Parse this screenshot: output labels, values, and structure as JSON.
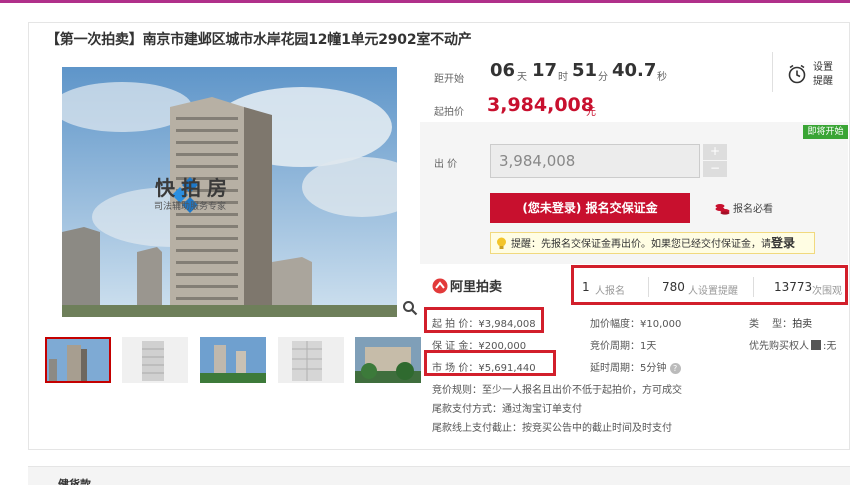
{
  "title": "【第一次拍卖】南京市建邺区城市水岸花园12幢1单元2902室不动产",
  "countdown": {
    "label": "距开始",
    "days": "06",
    "days_unit": "天",
    "hours": "17",
    "hours_unit": "时",
    "minutes": "51",
    "minutes_unit": "分",
    "seconds": "40.7",
    "seconds_unit": "秒"
  },
  "start_price": {
    "label": "起拍价",
    "value": "3,984,008",
    "unit": "元"
  },
  "setting_reminder": {
    "line1": "设置",
    "line2": "提醒"
  },
  "badge": "即将开始",
  "bid": {
    "label": "出 价",
    "value": "3,984,008",
    "plus": "+",
    "minus": "−",
    "button": "(您未登录) 报名交保证金",
    "must_read": "报名必看",
    "reminder_text": "提醒：先报名交保证金再出价。如果您已经交付保证金，请",
    "reminder_link": "登录"
  },
  "platform": {
    "name": "阿里拍卖"
  },
  "stats": [
    {
      "num": "1",
      "label": "人报名"
    },
    {
      "num": "780",
      "label": "人设置提醒"
    },
    {
      "num": "13773",
      "label": "次围观"
    }
  ],
  "watermark": {
    "title": "快拍房",
    "subtitle": "司法辅助服务专家"
  },
  "details": {
    "start_price": "起 拍 价：¥3,984,008",
    "deposit": "保 证 金：¥200,000",
    "market_price": "市 场 价：¥5,691,440",
    "increment": "加价幅度：¥10,000",
    "bid_cycle": "竞价周期：1天",
    "delay_cycle": "延时周期：5分钟",
    "type": "类　 型：",
    "type_value": "拍卖",
    "priority": "优先购买权人",
    "priority_value": "无",
    "rule": "竞价规则：至少一人报名且出价不低于起拍价，方可成交",
    "payment": "尾款支付方式：通过淘宝订单支付",
    "deadline": "尾款线上支付截止：按竞买公告中的截止时间及时支付"
  },
  "bottom": {
    "text": "健货款"
  },
  "colors": {
    "accent": "#c8102e",
    "highlight": "#d21f2b",
    "green": "#3aa535"
  }
}
